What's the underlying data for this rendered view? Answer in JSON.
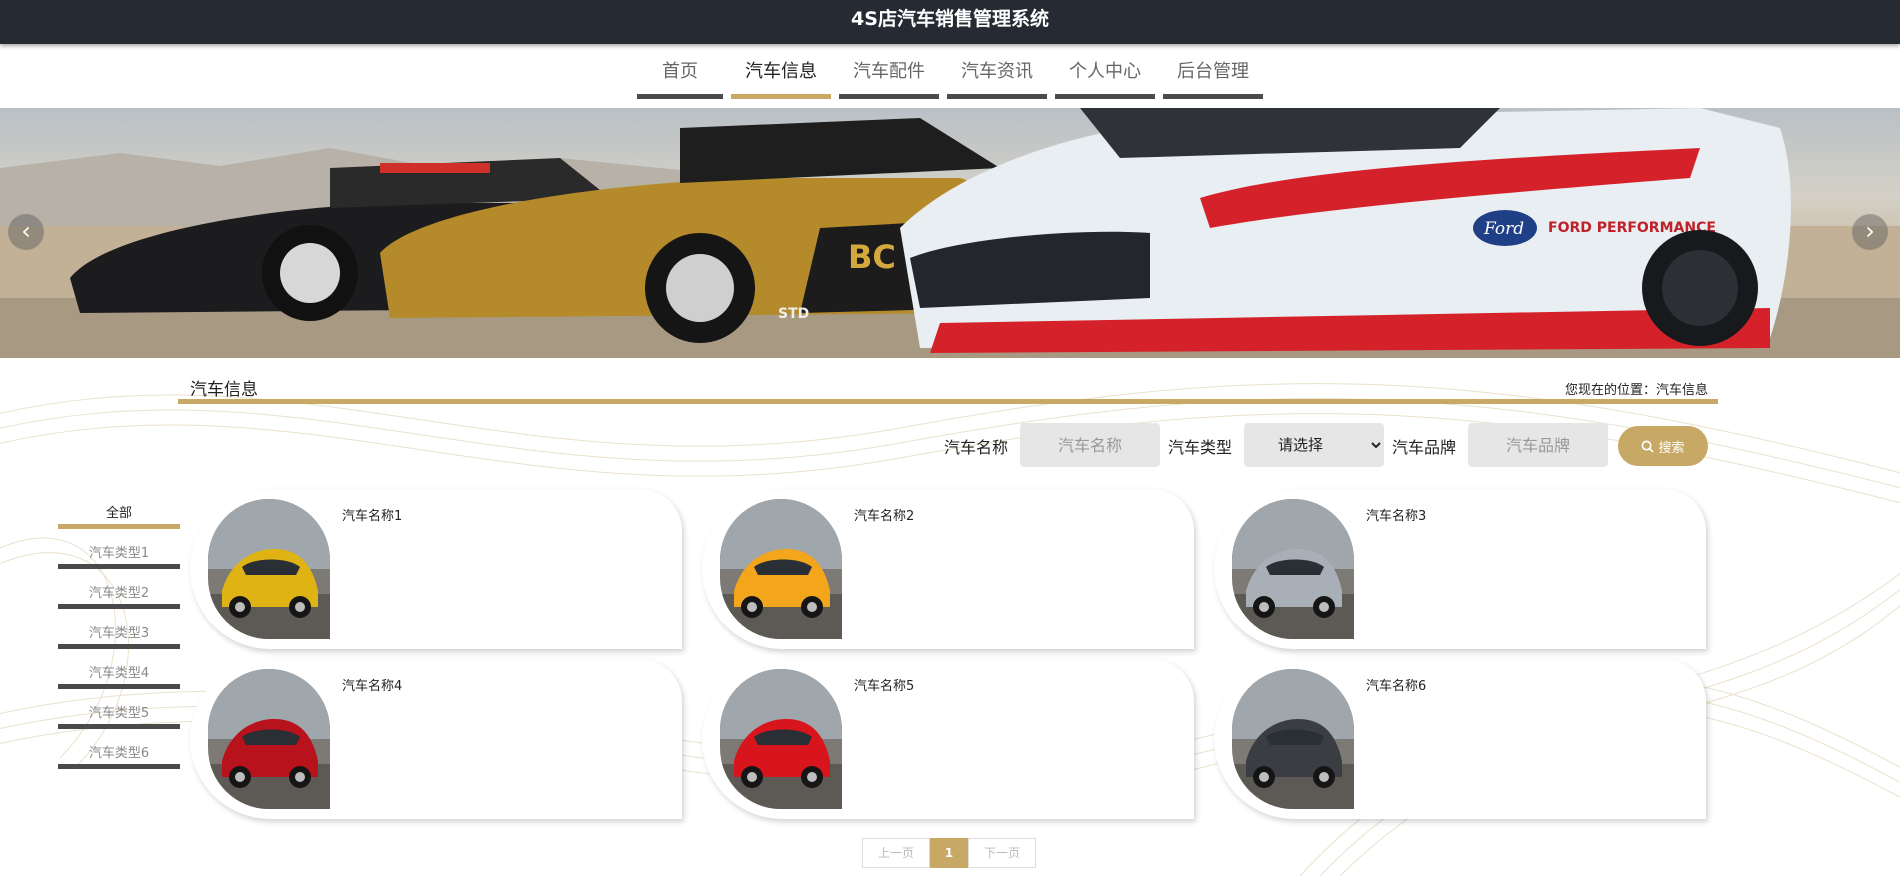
{
  "app": {
    "title": "4S店汽车销售管理系统"
  },
  "nav": {
    "items": [
      {
        "label": "首页",
        "active": false
      },
      {
        "label": "汽车信息",
        "active": true
      },
      {
        "label": "汽车配件",
        "active": false
      },
      {
        "label": "汽车资讯",
        "active": false
      },
      {
        "label": "个人中心",
        "active": false
      },
      {
        "label": "后台管理",
        "active": false
      }
    ]
  },
  "banner": {
    "prev_icon": "‹",
    "next_icon": "›",
    "car_texts": [
      "FORD PERFORMANCE",
      "Ford",
      "BC",
      "STD"
    ]
  },
  "section": {
    "title": "汽车信息",
    "breadcrumb": "您现在的位置：汽车信息"
  },
  "search": {
    "name_label": "汽车名称",
    "name_placeholder": "汽车名称",
    "type_label": "汽车类型",
    "type_selected": "请选择",
    "brand_label": "汽车品牌",
    "brand_placeholder": "汽车品牌",
    "button_label": "搜索"
  },
  "sidebar": {
    "items": [
      {
        "label": "全部",
        "active": true
      },
      {
        "label": "汽车类型1",
        "active": false
      },
      {
        "label": "汽车类型2",
        "active": false
      },
      {
        "label": "汽车类型3",
        "active": false
      },
      {
        "label": "汽车类型4",
        "active": false
      },
      {
        "label": "汽车类型5",
        "active": false
      },
      {
        "label": "汽车类型6",
        "active": false
      }
    ]
  },
  "cars": [
    {
      "name": "汽车名称1",
      "color": "#e0b314"
    },
    {
      "name": "汽车名称2",
      "color": "#f3a51b"
    },
    {
      "name": "汽车名称3",
      "color": "#a9afb6"
    },
    {
      "name": "汽车名称4",
      "color": "#b8121d"
    },
    {
      "name": "汽车名称5",
      "color": "#d8141c"
    },
    {
      "name": "汽车名称6",
      "color": "#3a3d42"
    }
  ],
  "pagination": {
    "prev": "上一页",
    "current": "1",
    "next": "下一页"
  },
  "colors": {
    "accent": "#c8a865",
    "header_bg": "#252a33",
    "inactive_bar": "#4a4a4a"
  }
}
